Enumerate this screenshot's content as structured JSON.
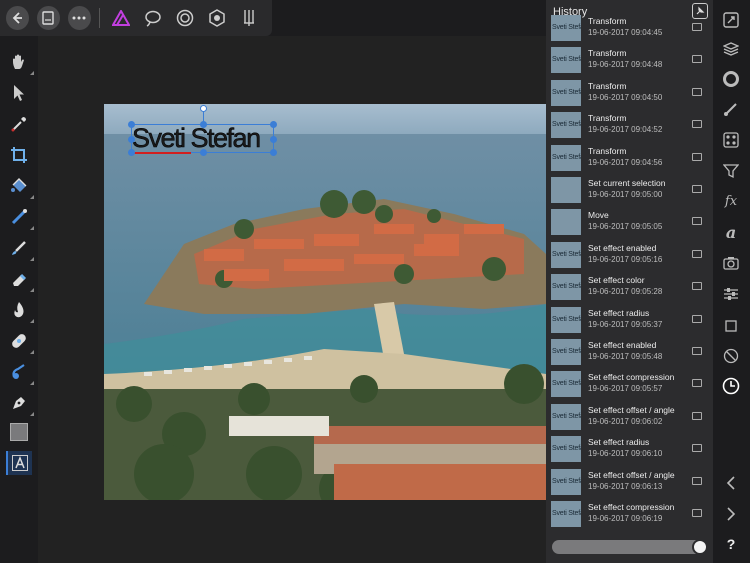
{
  "colors": {
    "accent": "#c23fe0",
    "panel": "#2c2c2e",
    "background": "#1c1c1e",
    "selection": "#3b7ed6"
  },
  "topbar": {
    "icons": [
      "back-icon",
      "document-icon",
      "more-icon",
      "affinity-photo-persona-icon",
      "liquify-persona-icon",
      "develop-persona-icon",
      "tone-mapping-persona-icon",
      "export-persona-icon"
    ]
  },
  "tools": [
    "hand-icon",
    "move-icon",
    "color-picker-icon",
    "crop-icon",
    "flood-fill-icon",
    "gradient-icon",
    "paint-brush-icon",
    "erase-brush-icon",
    "dodge-icon",
    "healing-icon",
    "smudge-icon",
    "pen-icon",
    "color-swatch-icon",
    "text-icon"
  ],
  "canvas": {
    "text_layer": "Sveti Stefan"
  },
  "history": {
    "title": "History",
    "items": [
      {
        "name": "Transform",
        "time": "19-06-2017 09:04:45",
        "thumb": "Sveti Stefan"
      },
      {
        "name": "Transform",
        "time": "19-06-2017 09:04:48",
        "thumb": "Sveti Stefan"
      },
      {
        "name": "Transform",
        "time": "19-06-2017 09:04:50",
        "thumb": "Sveti Stefan"
      },
      {
        "name": "Transform",
        "time": "19-06-2017 09:04:52",
        "thumb": "Sveti Stefan"
      },
      {
        "name": "Transform",
        "time": "19-06-2017 09:04:56",
        "thumb": "Sveti Stefan"
      },
      {
        "name": "Set current selection",
        "time": "19-06-2017 09:05:00",
        "thumb": ""
      },
      {
        "name": "Move",
        "time": "19-06-2017 09:05:05",
        "thumb": ""
      },
      {
        "name": "Set effect enabled",
        "time": "19-06-2017 09:05:16",
        "thumb": "Sveti Stefan"
      },
      {
        "name": "Set effect color",
        "time": "19-06-2017 09:05:28",
        "thumb": "Sveti Stefan"
      },
      {
        "name": "Set effect radius",
        "time": "19-06-2017 09:05:37",
        "thumb": "Sveti Stefan"
      },
      {
        "name": "Set effect enabled",
        "time": "19-06-2017 09:05:48",
        "thumb": "Sveti Stefan"
      },
      {
        "name": "Set effect compression",
        "time": "19-06-2017 09:05:57",
        "thumb": "Sveti Stefan"
      },
      {
        "name": "Set effect offset / angle",
        "time": "19-06-2017 09:06:02",
        "thumb": "Sveti Stefan"
      },
      {
        "name": "Set effect radius",
        "time": "19-06-2017 09:06:10",
        "thumb": "Sveti Stefan"
      },
      {
        "name": "Set effect offset / angle",
        "time": "19-06-2017 09:06:13",
        "thumb": "Sveti Stefan"
      },
      {
        "name": "Set effect compression",
        "time": "19-06-2017 09:06:19",
        "thumb": "Sveti Stefan"
      }
    ]
  },
  "studio": {
    "icons": [
      "navigator-icon",
      "layers-icon",
      "color-icon",
      "brushes-icon",
      "swatches-icon",
      "adjustments-icon",
      "effects-icon",
      "text-styles-icon",
      "stock-icon",
      "transform-icon",
      "constraints-icon",
      "channels-icon",
      "history-icon",
      "undo-icon",
      "redo-icon",
      "help-icon"
    ],
    "help_label": "?"
  }
}
